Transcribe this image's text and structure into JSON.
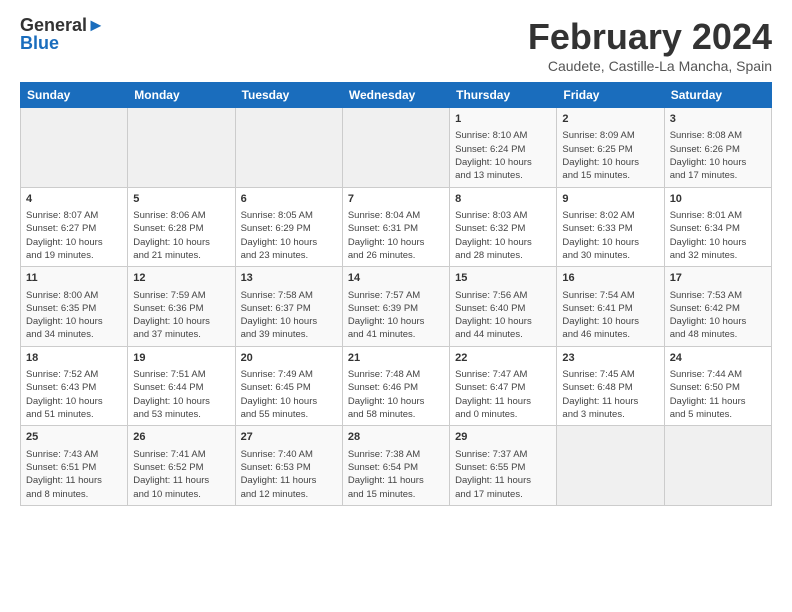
{
  "header": {
    "logo_line1": "General",
    "logo_line2": "Blue",
    "title": "February 2024",
    "subtitle": "Caudete, Castille-La Mancha, Spain"
  },
  "days_of_week": [
    "Sunday",
    "Monday",
    "Tuesday",
    "Wednesday",
    "Thursday",
    "Friday",
    "Saturday"
  ],
  "weeks": [
    [
      {
        "num": "",
        "info": ""
      },
      {
        "num": "",
        "info": ""
      },
      {
        "num": "",
        "info": ""
      },
      {
        "num": "",
        "info": ""
      },
      {
        "num": "1",
        "info": "Sunrise: 8:10 AM\nSunset: 6:24 PM\nDaylight: 10 hours\nand 13 minutes."
      },
      {
        "num": "2",
        "info": "Sunrise: 8:09 AM\nSunset: 6:25 PM\nDaylight: 10 hours\nand 15 minutes."
      },
      {
        "num": "3",
        "info": "Sunrise: 8:08 AM\nSunset: 6:26 PM\nDaylight: 10 hours\nand 17 minutes."
      }
    ],
    [
      {
        "num": "4",
        "info": "Sunrise: 8:07 AM\nSunset: 6:27 PM\nDaylight: 10 hours\nand 19 minutes."
      },
      {
        "num": "5",
        "info": "Sunrise: 8:06 AM\nSunset: 6:28 PM\nDaylight: 10 hours\nand 21 minutes."
      },
      {
        "num": "6",
        "info": "Sunrise: 8:05 AM\nSunset: 6:29 PM\nDaylight: 10 hours\nand 23 minutes."
      },
      {
        "num": "7",
        "info": "Sunrise: 8:04 AM\nSunset: 6:31 PM\nDaylight: 10 hours\nand 26 minutes."
      },
      {
        "num": "8",
        "info": "Sunrise: 8:03 AM\nSunset: 6:32 PM\nDaylight: 10 hours\nand 28 minutes."
      },
      {
        "num": "9",
        "info": "Sunrise: 8:02 AM\nSunset: 6:33 PM\nDaylight: 10 hours\nand 30 minutes."
      },
      {
        "num": "10",
        "info": "Sunrise: 8:01 AM\nSunset: 6:34 PM\nDaylight: 10 hours\nand 32 minutes."
      }
    ],
    [
      {
        "num": "11",
        "info": "Sunrise: 8:00 AM\nSunset: 6:35 PM\nDaylight: 10 hours\nand 34 minutes."
      },
      {
        "num": "12",
        "info": "Sunrise: 7:59 AM\nSunset: 6:36 PM\nDaylight: 10 hours\nand 37 minutes."
      },
      {
        "num": "13",
        "info": "Sunrise: 7:58 AM\nSunset: 6:37 PM\nDaylight: 10 hours\nand 39 minutes."
      },
      {
        "num": "14",
        "info": "Sunrise: 7:57 AM\nSunset: 6:39 PM\nDaylight: 10 hours\nand 41 minutes."
      },
      {
        "num": "15",
        "info": "Sunrise: 7:56 AM\nSunset: 6:40 PM\nDaylight: 10 hours\nand 44 minutes."
      },
      {
        "num": "16",
        "info": "Sunrise: 7:54 AM\nSunset: 6:41 PM\nDaylight: 10 hours\nand 46 minutes."
      },
      {
        "num": "17",
        "info": "Sunrise: 7:53 AM\nSunset: 6:42 PM\nDaylight: 10 hours\nand 48 minutes."
      }
    ],
    [
      {
        "num": "18",
        "info": "Sunrise: 7:52 AM\nSunset: 6:43 PM\nDaylight: 10 hours\nand 51 minutes."
      },
      {
        "num": "19",
        "info": "Sunrise: 7:51 AM\nSunset: 6:44 PM\nDaylight: 10 hours\nand 53 minutes."
      },
      {
        "num": "20",
        "info": "Sunrise: 7:49 AM\nSunset: 6:45 PM\nDaylight: 10 hours\nand 55 minutes."
      },
      {
        "num": "21",
        "info": "Sunrise: 7:48 AM\nSunset: 6:46 PM\nDaylight: 10 hours\nand 58 minutes."
      },
      {
        "num": "22",
        "info": "Sunrise: 7:47 AM\nSunset: 6:47 PM\nDaylight: 11 hours\nand 0 minutes."
      },
      {
        "num": "23",
        "info": "Sunrise: 7:45 AM\nSunset: 6:48 PM\nDaylight: 11 hours\nand 3 minutes."
      },
      {
        "num": "24",
        "info": "Sunrise: 7:44 AM\nSunset: 6:50 PM\nDaylight: 11 hours\nand 5 minutes."
      }
    ],
    [
      {
        "num": "25",
        "info": "Sunrise: 7:43 AM\nSunset: 6:51 PM\nDaylight: 11 hours\nand 8 minutes."
      },
      {
        "num": "26",
        "info": "Sunrise: 7:41 AM\nSunset: 6:52 PM\nDaylight: 11 hours\nand 10 minutes."
      },
      {
        "num": "27",
        "info": "Sunrise: 7:40 AM\nSunset: 6:53 PM\nDaylight: 11 hours\nand 12 minutes."
      },
      {
        "num": "28",
        "info": "Sunrise: 7:38 AM\nSunset: 6:54 PM\nDaylight: 11 hours\nand 15 minutes."
      },
      {
        "num": "29",
        "info": "Sunrise: 7:37 AM\nSunset: 6:55 PM\nDaylight: 11 hours\nand 17 minutes."
      },
      {
        "num": "",
        "info": ""
      },
      {
        "num": "",
        "info": ""
      }
    ]
  ]
}
